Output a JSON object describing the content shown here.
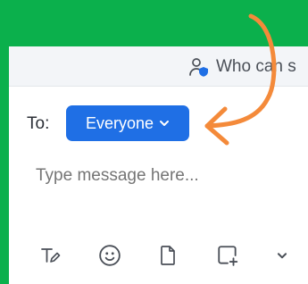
{
  "header": {
    "who_can_see_text": "Who can s",
    "who_icon": "user-shield-icon"
  },
  "recipient": {
    "label": "To:",
    "selected": "Everyone",
    "dropdown_icon": "chevron-down-icon"
  },
  "message": {
    "placeholder": "Type message here..."
  },
  "toolbar": {
    "icons": [
      "format-text-icon",
      "emoji-icon",
      "file-icon",
      "add-screenshot-icon",
      "more-chevron-icon"
    ]
  },
  "colors": {
    "background": "#0bb04c",
    "accent": "#1f6fe5",
    "annotation_arrow": "#f48a3a"
  }
}
